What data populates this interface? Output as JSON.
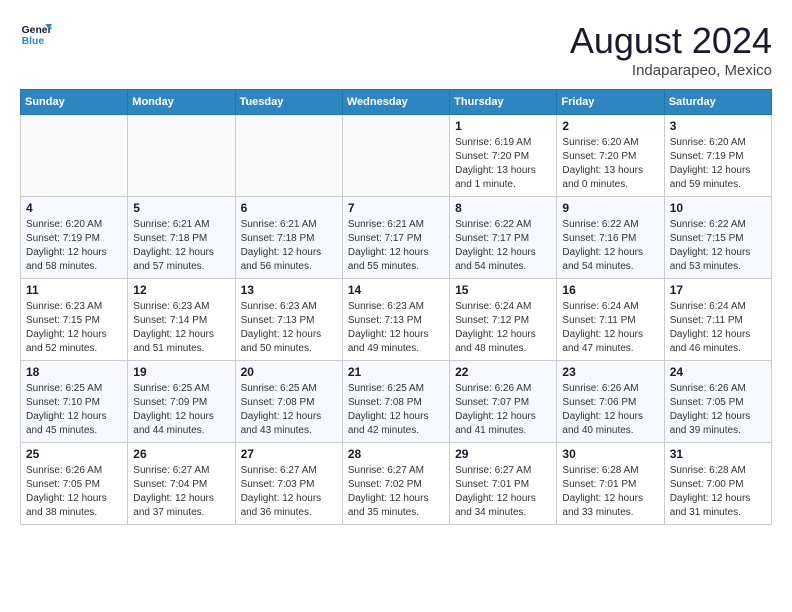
{
  "logo": {
    "text_general": "General",
    "text_blue": "Blue"
  },
  "header": {
    "month_year": "August 2024",
    "location": "Indaparapeo, Mexico"
  },
  "weekdays": [
    "Sunday",
    "Monday",
    "Tuesday",
    "Wednesday",
    "Thursday",
    "Friday",
    "Saturday"
  ],
  "weeks": [
    [
      {
        "day": "",
        "info": ""
      },
      {
        "day": "",
        "info": ""
      },
      {
        "day": "",
        "info": ""
      },
      {
        "day": "",
        "info": ""
      },
      {
        "day": "1",
        "info": "Sunrise: 6:19 AM\nSunset: 7:20 PM\nDaylight: 13 hours\nand 1 minute."
      },
      {
        "day": "2",
        "info": "Sunrise: 6:20 AM\nSunset: 7:20 PM\nDaylight: 13 hours\nand 0 minutes."
      },
      {
        "day": "3",
        "info": "Sunrise: 6:20 AM\nSunset: 7:19 PM\nDaylight: 12 hours\nand 59 minutes."
      }
    ],
    [
      {
        "day": "4",
        "info": "Sunrise: 6:20 AM\nSunset: 7:19 PM\nDaylight: 12 hours\nand 58 minutes."
      },
      {
        "day": "5",
        "info": "Sunrise: 6:21 AM\nSunset: 7:18 PM\nDaylight: 12 hours\nand 57 minutes."
      },
      {
        "day": "6",
        "info": "Sunrise: 6:21 AM\nSunset: 7:18 PM\nDaylight: 12 hours\nand 56 minutes."
      },
      {
        "day": "7",
        "info": "Sunrise: 6:21 AM\nSunset: 7:17 PM\nDaylight: 12 hours\nand 55 minutes."
      },
      {
        "day": "8",
        "info": "Sunrise: 6:22 AM\nSunset: 7:17 PM\nDaylight: 12 hours\nand 54 minutes."
      },
      {
        "day": "9",
        "info": "Sunrise: 6:22 AM\nSunset: 7:16 PM\nDaylight: 12 hours\nand 54 minutes."
      },
      {
        "day": "10",
        "info": "Sunrise: 6:22 AM\nSunset: 7:15 PM\nDaylight: 12 hours\nand 53 minutes."
      }
    ],
    [
      {
        "day": "11",
        "info": "Sunrise: 6:23 AM\nSunset: 7:15 PM\nDaylight: 12 hours\nand 52 minutes."
      },
      {
        "day": "12",
        "info": "Sunrise: 6:23 AM\nSunset: 7:14 PM\nDaylight: 12 hours\nand 51 minutes."
      },
      {
        "day": "13",
        "info": "Sunrise: 6:23 AM\nSunset: 7:13 PM\nDaylight: 12 hours\nand 50 minutes."
      },
      {
        "day": "14",
        "info": "Sunrise: 6:23 AM\nSunset: 7:13 PM\nDaylight: 12 hours\nand 49 minutes."
      },
      {
        "day": "15",
        "info": "Sunrise: 6:24 AM\nSunset: 7:12 PM\nDaylight: 12 hours\nand 48 minutes."
      },
      {
        "day": "16",
        "info": "Sunrise: 6:24 AM\nSunset: 7:11 PM\nDaylight: 12 hours\nand 47 minutes."
      },
      {
        "day": "17",
        "info": "Sunrise: 6:24 AM\nSunset: 7:11 PM\nDaylight: 12 hours\nand 46 minutes."
      }
    ],
    [
      {
        "day": "18",
        "info": "Sunrise: 6:25 AM\nSunset: 7:10 PM\nDaylight: 12 hours\nand 45 minutes."
      },
      {
        "day": "19",
        "info": "Sunrise: 6:25 AM\nSunset: 7:09 PM\nDaylight: 12 hours\nand 44 minutes."
      },
      {
        "day": "20",
        "info": "Sunrise: 6:25 AM\nSunset: 7:08 PM\nDaylight: 12 hours\nand 43 minutes."
      },
      {
        "day": "21",
        "info": "Sunrise: 6:25 AM\nSunset: 7:08 PM\nDaylight: 12 hours\nand 42 minutes."
      },
      {
        "day": "22",
        "info": "Sunrise: 6:26 AM\nSunset: 7:07 PM\nDaylight: 12 hours\nand 41 minutes."
      },
      {
        "day": "23",
        "info": "Sunrise: 6:26 AM\nSunset: 7:06 PM\nDaylight: 12 hours\nand 40 minutes."
      },
      {
        "day": "24",
        "info": "Sunrise: 6:26 AM\nSunset: 7:05 PM\nDaylight: 12 hours\nand 39 minutes."
      }
    ],
    [
      {
        "day": "25",
        "info": "Sunrise: 6:26 AM\nSunset: 7:05 PM\nDaylight: 12 hours\nand 38 minutes."
      },
      {
        "day": "26",
        "info": "Sunrise: 6:27 AM\nSunset: 7:04 PM\nDaylight: 12 hours\nand 37 minutes."
      },
      {
        "day": "27",
        "info": "Sunrise: 6:27 AM\nSunset: 7:03 PM\nDaylight: 12 hours\nand 36 minutes."
      },
      {
        "day": "28",
        "info": "Sunrise: 6:27 AM\nSunset: 7:02 PM\nDaylight: 12 hours\nand 35 minutes."
      },
      {
        "day": "29",
        "info": "Sunrise: 6:27 AM\nSunset: 7:01 PM\nDaylight: 12 hours\nand 34 minutes."
      },
      {
        "day": "30",
        "info": "Sunrise: 6:28 AM\nSunset: 7:01 PM\nDaylight: 12 hours\nand 33 minutes."
      },
      {
        "day": "31",
        "info": "Sunrise: 6:28 AM\nSunset: 7:00 PM\nDaylight: 12 hours\nand 31 minutes."
      }
    ]
  ]
}
